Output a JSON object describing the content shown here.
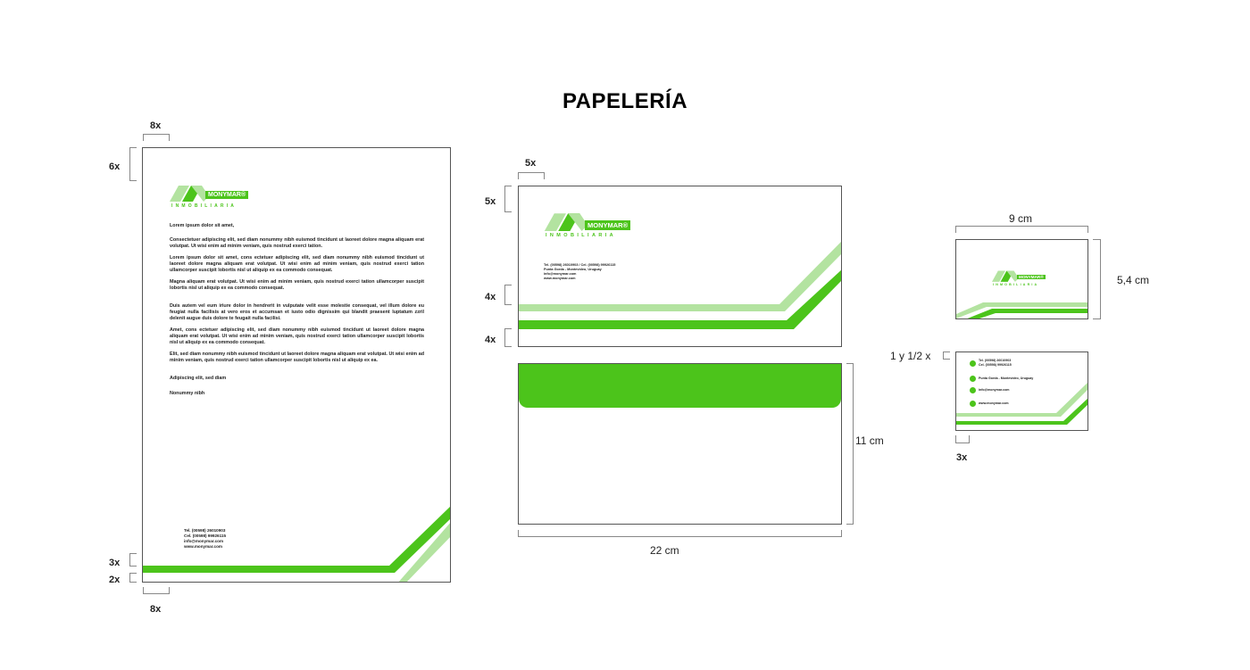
{
  "title": "PAPELERÍA",
  "colors": {
    "brand_green": "#4cc41b",
    "light_green": "#b3e3a0"
  },
  "brand": {
    "name": "MONYMAR®",
    "subtitle": "INMOBILIARIA"
  },
  "letterhead": {
    "dims": {
      "left_margin_top": "8x",
      "top_margin": "6x",
      "line_gap": "3x",
      "bottom_gap": "2x",
      "left_margin_bottom": "8x"
    },
    "greeting": "Lorem ipsum dolor sit amet,",
    "paragraphs": [
      "Consectetuer adipiscing elit, sed diam nonummy nibh euismod tincidunt ut laoreet dolore magna aliquam erat volutpat. Ut wisi enim ad minim veniam, quis nostrud exerci tation.",
      "Lorem ipsum dolor sit amet, cons ectetuer adipiscing elit, sed diam nonummy nibh euismod tincidunt ut laoreet dolore magna aliquam erat volutpat. Ut wisi enim ad minim veniam, quis nostrud exerci tation ullamcorper suscipit lobortis nisl ut aliquip ex ea commodo consequat.",
      "Magna aliquam erat volutpat. Ut wisi enim ad minim veniam, quis nostrud exerci tation ullamcorper suscipit lobortis nisl ut aliquip ex ea commodo consequat.",
      "Duis autem vel eum iriure dolor in hendrerit in vulputate velit esse molestie consequat, vel illum dolore eu feugiat nulla facilisis at vero eros et accumsan et iusto odio dignissim qui blandit praesent luptatum zzril delenit augue duis dolore te feugait nulla facilisi.",
      "Amet, cons ectetuer adipiscing elit, sed diam nonummy nibh euismod tincidunt ut laoreet dolore magna aliquam erat volutpat. Ut wisi enim ad minim veniam, quis nostrud exerci tation ullamcorper suscipit lobortis nisl ut aliquip ex ea commodo consequat.",
      "Elit, sed diam nonummy nibh euismod tincidunt ut laoreet dolore magna aliquam erat volutpat. Ut wisi enim ad minim veniam, quis nostrud exerci tation ullamcorper suscipit lobortis nisl ut aliquip ex ea.",
      "Adipiscing elit, sed diam",
      "Nonummy nibh"
    ],
    "contact": [
      "Tel. (00598) 26010903",
      "Cel. (00598) 99926115",
      "info@monymar.com",
      "www.monymar.com"
    ]
  },
  "envelope": {
    "dims": {
      "left": "5x",
      "top": "5x",
      "stripe1": "4x",
      "stripe2": "4x",
      "height": "11 cm",
      "width": "22 cm"
    },
    "contact": [
      "Tel. (00598) 26010903 / Cel. (00598) 99926115",
      "Punta Gorda - Montevideo, Uruguay",
      "info@monymar.com",
      "www.monymar.com"
    ]
  },
  "card": {
    "dims": {
      "width": "9 cm",
      "height": "5,4 cm",
      "top": "1 y 1/2 x",
      "left": "3x"
    },
    "contact": [
      "Tel. (00598) 26010903",
      "Cel. (00598) 99926115",
      "Punta Gorda - Montevideo, Uruguay",
      "info@monymar.com",
      "www.monymar.com"
    ]
  }
}
